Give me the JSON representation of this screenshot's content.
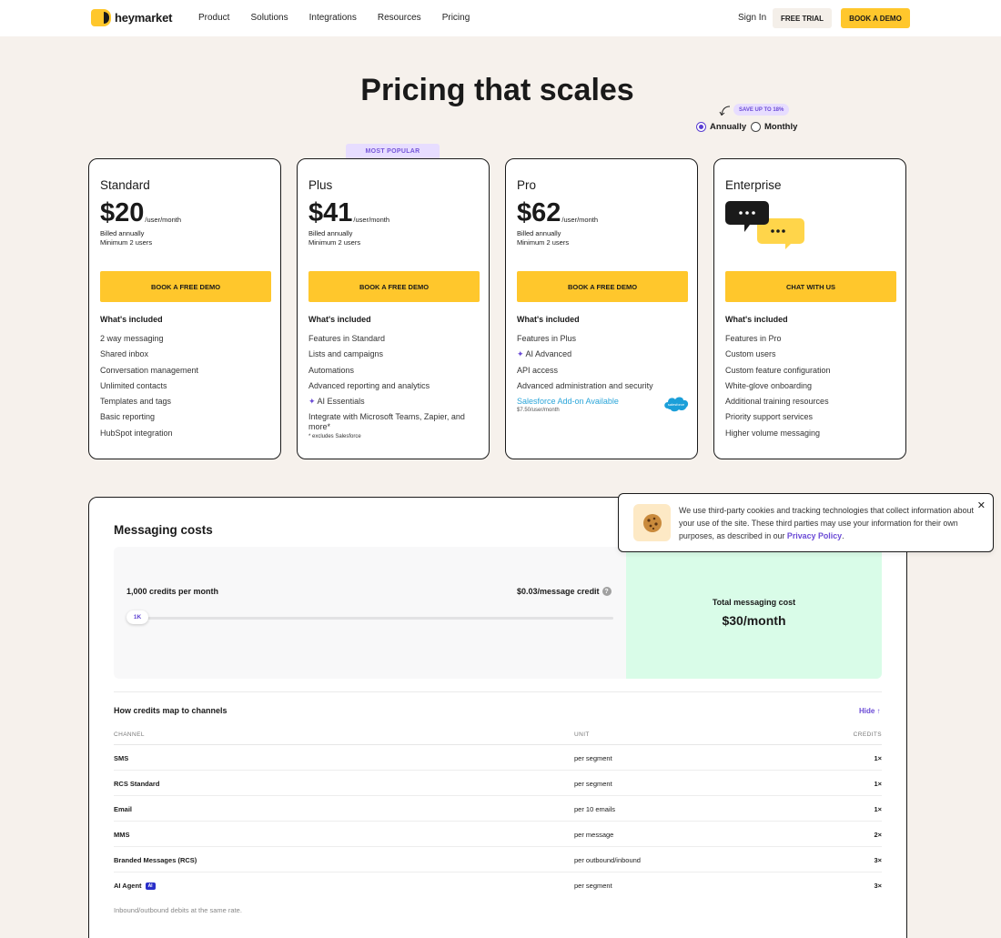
{
  "nav": {
    "logo_text": "heymarket",
    "links": [
      "Product",
      "Solutions",
      "Integrations",
      "Resources",
      "Pricing"
    ],
    "sign_in": "Sign In",
    "free_trial": "FREE TRIAL",
    "book_demo": "BOOK A DEMO"
  },
  "hero": {
    "title": "Pricing that scales",
    "save_badge": "SAVE UP TO 18%",
    "billing_options": [
      {
        "label": "Annually",
        "selected": true
      },
      {
        "label": "Monthly",
        "selected": false
      }
    ]
  },
  "most_popular": "MOST POPULAR",
  "included_title": "What's included",
  "plans": [
    {
      "name": "Standard",
      "price": "$20",
      "unit": "/user/month",
      "billed": "Billed annually",
      "minimum": "Minimum 2 users",
      "cta": "BOOK A FREE DEMO",
      "features": [
        "2 way messaging",
        "Shared inbox",
        "Conversation management",
        "Unlimited contacts",
        "Templates and tags",
        "Basic reporting",
        "HubSpot integration"
      ]
    },
    {
      "name": "Plus",
      "price": "$41",
      "unit": "/user/month",
      "billed": "Billed annually",
      "minimum": "Minimum 2 users",
      "cta": "BOOK A FREE DEMO",
      "features": [
        "Features in Standard",
        "Lists and campaigns",
        "Automations",
        "Advanced reporting and analytics"
      ],
      "ai_feature": "AI Essentials",
      "integration_feature": "Integrate with Microsoft Teams, Zapier, and more*",
      "footnote": "* excludes Salesforce"
    },
    {
      "name": "Pro",
      "price": "$62",
      "unit": "/user/month",
      "billed": "Billed annually",
      "minimum": "Minimum 2 users",
      "cta": "BOOK A FREE DEMO",
      "first_feature": "Features in Plus",
      "ai_feature": "AI Advanced",
      "features": [
        "API access",
        "Advanced administration and security"
      ],
      "salesforce_link": "Salesforce Add-on Available",
      "salesforce_price": "$7.50/user/month",
      "salesforce_logo_text": "salesforce"
    },
    {
      "name": "Enterprise",
      "cta": "CHAT WITH US",
      "features": [
        "Features in Pro",
        "Custom users",
        "Custom feature configuration",
        "White-glove onboarding",
        "Additional training resources",
        "Priority support services",
        "Higher volume messaging"
      ]
    }
  ],
  "messaging": {
    "title": "Messaging costs",
    "credits_label": "1,000 credits per month",
    "rate_label": "$0.03/message credit",
    "slider_value": "1K",
    "total_label": "Total messaging cost",
    "total_value": "$30/month",
    "map_title": "How credits map to channels",
    "hide_label": "Hide ↑",
    "columns": [
      "CHANNEL",
      "UNIT",
      "CREDITS"
    ],
    "rows": [
      {
        "channel": "SMS",
        "unit": "per segment",
        "credits": "1×"
      },
      {
        "channel": "RCS Standard",
        "unit": "per segment",
        "credits": "1×"
      },
      {
        "channel": "Email",
        "unit": "per 10 emails",
        "credits": "1×"
      },
      {
        "channel": "MMS",
        "unit": "per message",
        "credits": "2×"
      },
      {
        "channel": "Branded Messages (RCS)",
        "unit": "per outbound/inbound",
        "credits": "3×"
      },
      {
        "channel": "AI Agent",
        "unit": "per segment",
        "credits": "3×",
        "badge": "AI"
      }
    ],
    "note": "Inbound/outbound debits at the same rate."
  },
  "cookie": {
    "text": "We use third-party cookies and tracking technologies that collect information about your use of the site. These third parties may use your information for their own purposes, as described in our ",
    "link": "Privacy Policy",
    "end": ".",
    "close": "✕"
  },
  "colors": {
    "accent_yellow": "#ffc72c",
    "accent_purple": "#6b4bd6",
    "mint": "#d9fce8",
    "page_bg": "#f6f1ec"
  }
}
